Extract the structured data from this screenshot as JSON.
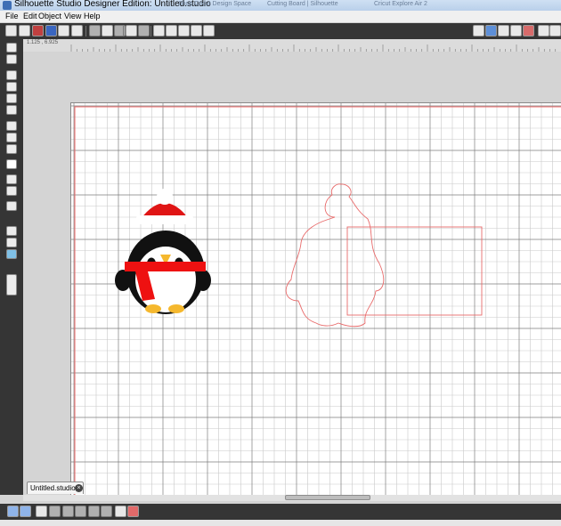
{
  "window": {
    "title": "Silhouette Studio Designer Edition: Untitled.studio",
    "background_tabs": [
      "Shop Cricut Design Space",
      "Cutting Board | Silhouette",
      "Cricut Explore Air 2"
    ]
  },
  "menu": {
    "items": [
      "File",
      "Edit",
      "Object",
      "View",
      "Help"
    ]
  },
  "ruler": {
    "coordinates": "1.125 , 6.925"
  },
  "document": {
    "tab_label": "Untitled.studio",
    "close_glyph": "×"
  },
  "colors": {
    "accent": "#3f6fb5",
    "panel": "#353535",
    "grid_major": "#7d7d7d",
    "grid_minor": "#c8c8c8",
    "page_border": "#f06a6a",
    "cut_line": "#e86a6a",
    "hat_red": "#e01515",
    "scarf_red": "#ee1111",
    "beak": "#f5b82e",
    "feet": "#f5b82e"
  },
  "icons": {
    "toolbar": [
      "new-icon",
      "open-icon",
      "save-icon",
      "save-as-icon",
      "print-icon",
      "send-to-silhouette-icon",
      "cut-icon",
      "copy-icon",
      "paste-icon",
      "undo-icon",
      "redo-icon",
      "zoom-in-icon",
      "zoom-out-icon",
      "zoom-select-icon",
      "pan-icon",
      "fit-to-page-icon"
    ],
    "right": [
      "fill-icon",
      "line-color-icon",
      "line-style-icon",
      "grid-icon",
      "cut-style-icon",
      "align-icon"
    ]
  }
}
